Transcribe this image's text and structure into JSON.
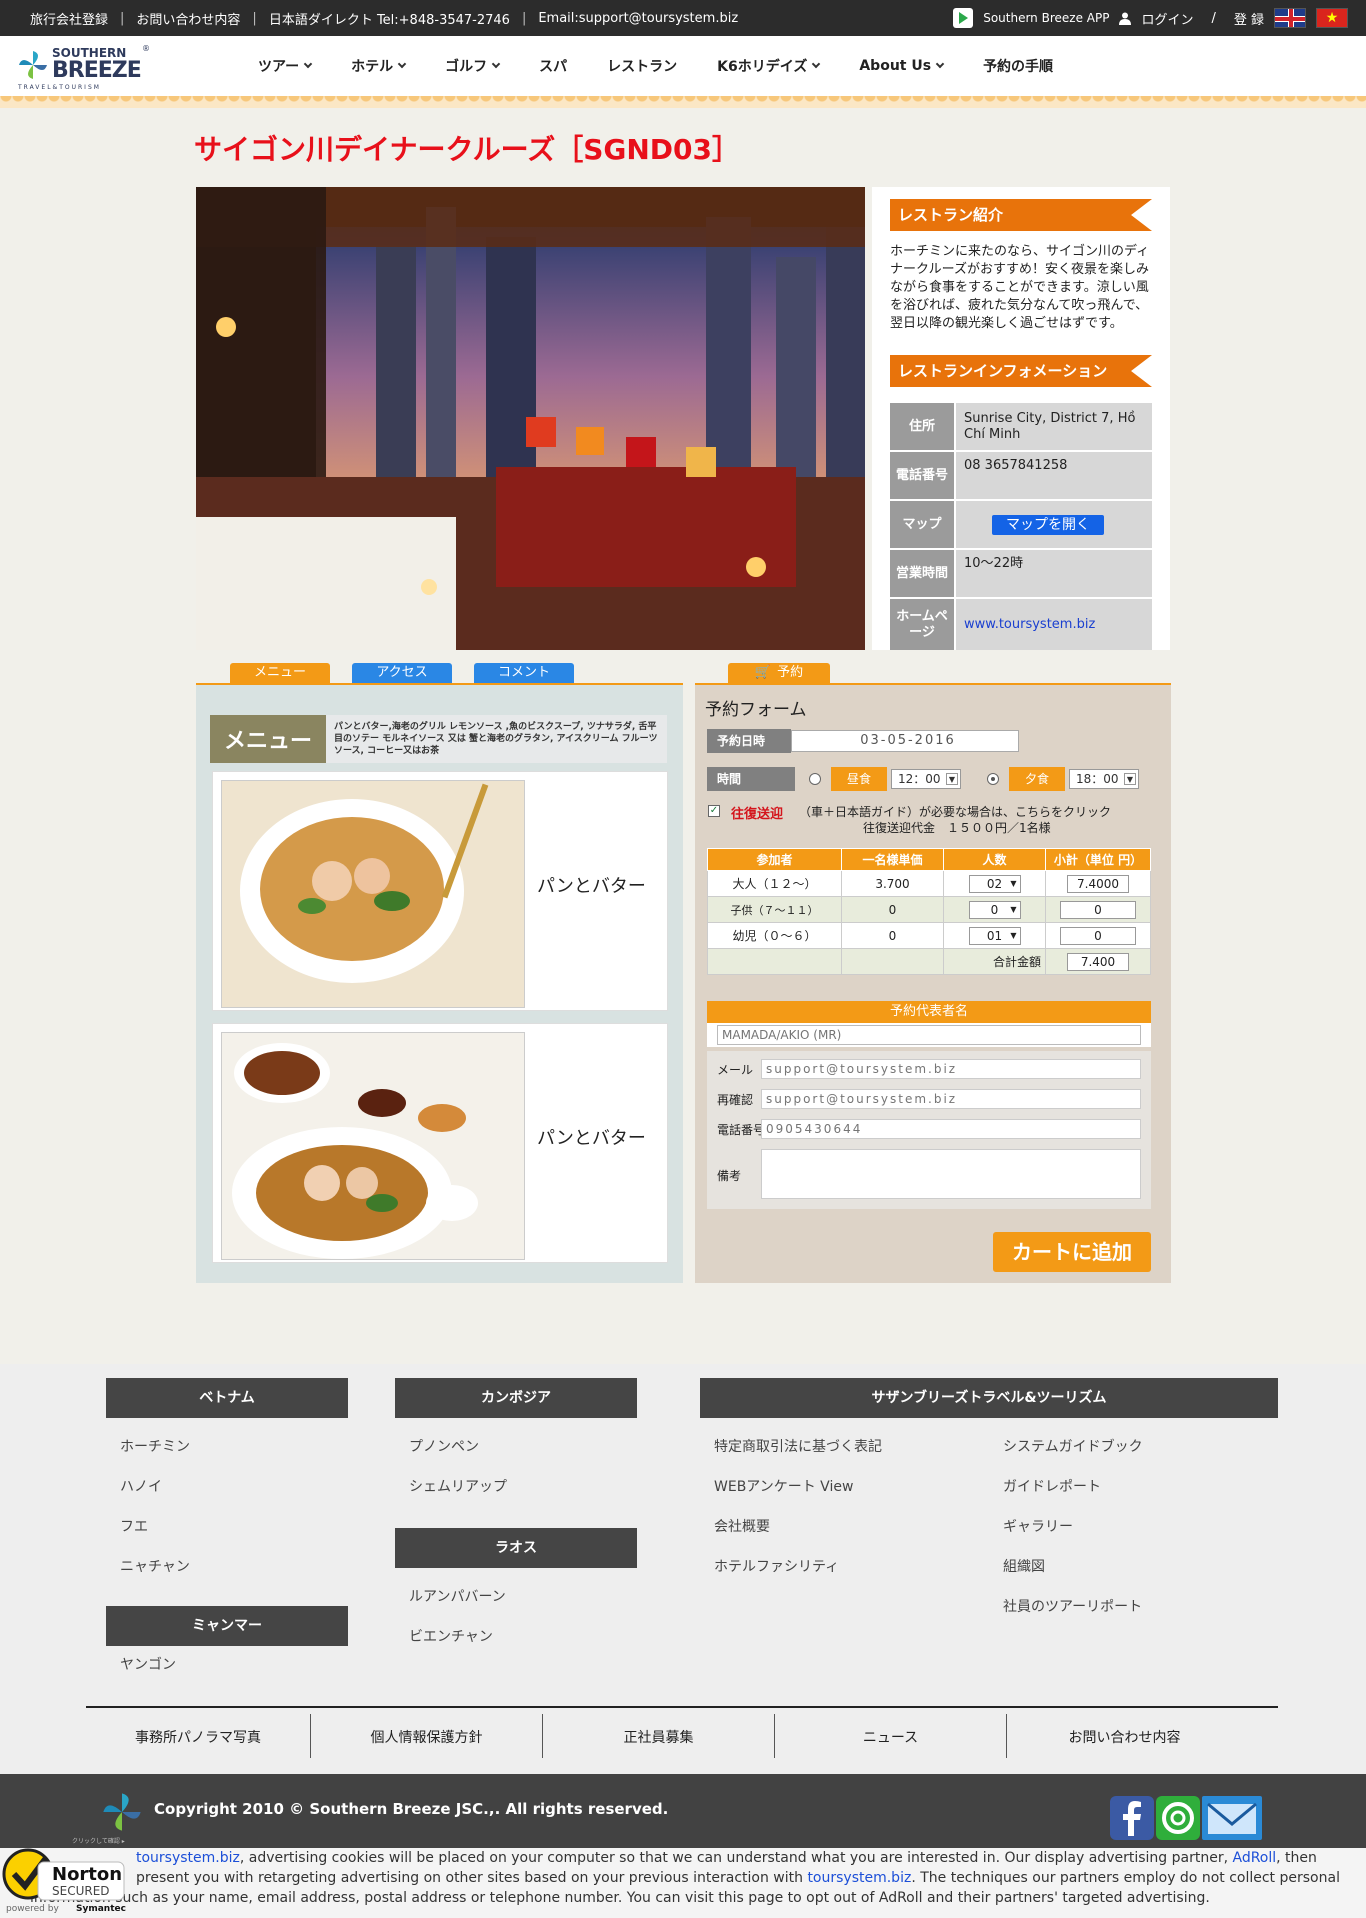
{
  "topbar": {
    "links": [
      "旅行会社登録",
      "お問い合わせ内容",
      "日本語ダイレクト Tel:+848-3547-2746",
      "Email:support@toursystem.biz"
    ],
    "app_label": "Southern Breeze APP",
    "login": "ログイン",
    "slash": "/",
    "register": "登 録"
  },
  "logo": {
    "line1": "SOUTHERN",
    "line2": "BREEZE",
    "line3": "TRAVEL&TOURISM",
    "reg": "®"
  },
  "nav": {
    "items": [
      "ツアー",
      "ホテル",
      "ゴルフ",
      "スパ",
      "レストラン",
      "K6ホリデイズ",
      "About Us",
      "予約の手順"
    ]
  },
  "page": {
    "title": "サイゴン川デイナークルーズ［SGND03］"
  },
  "info": {
    "intro_heading": "レストラン紹介",
    "intro_text": "ホーチミンに来たのなら、サイゴン川のディナークルーズがおすすめ！安く夜景を楽しみながら食事をすることができます。涼しい風を浴びれば、疲れた気分なんて吹っ飛んで、翌日以降の観光楽しく過ごせはずです。",
    "info_heading": "レストランインフォメーション",
    "rows": [
      {
        "key": "住所",
        "value": "Sunrise City, District 7, Hồ Chí Minh"
      },
      {
        "key": "電話番号",
        "value": "08 3657841258"
      },
      {
        "key": "マップ",
        "value": "マップを開く"
      },
      {
        "key": "営業時間",
        "value": "10〜22時"
      },
      {
        "key": "ホームページ",
        "value": "www.toursystem.biz"
      }
    ]
  },
  "tabs": {
    "menu": "メニュー",
    "access": "アクセス",
    "comment": "コメント",
    "booking": "予約"
  },
  "menu": {
    "label": "メニュー",
    "description": "パンとバター,海老のグリル レモンソース ,魚のビスクスープ, ツナサラダ, 舌平目のソテー モルネイソース 又は 蟹と海老のグラタン, アイスクリーム フルーツソース, コーヒー又はお茶",
    "dishes": [
      {
        "name": "パンとバター"
      },
      {
        "name": "パンとバター"
      }
    ]
  },
  "form": {
    "title": "予約フォーム",
    "date_label": "予約日時",
    "date_value": "03-05-2016",
    "time_label": "時間",
    "lunch_label": "昼食",
    "lunch_time": "12：00",
    "dinner_label": "夕食",
    "dinner_time": "18：00",
    "transfer_label": "往復送迎",
    "transfer_text": "（車＋日本語ガイド）が必要な場合は、こちらをクリック",
    "transfer_price": "往復送迎代金　１５００円／1名様",
    "table": {
      "headers": [
        "参加者",
        "一名様単価",
        "人数",
        "小計（単位 円）"
      ],
      "rows": [
        {
          "who": "大人（１２〜）",
          "price": "3.700",
          "qty": "02",
          "subtotal": "7.4000"
        },
        {
          "who": "子供（７〜１１）",
          "price": "0",
          "qty": "0",
          "subtotal": "0"
        },
        {
          "who": "幼児（０〜６）",
          "price": "0",
          "qty": "01",
          "subtotal": "0"
        }
      ],
      "total_label": "合計金額",
      "total_value": "7.400"
    },
    "rep_label": "予約代表者名",
    "rep_placeholder": "MAMADA/AKIO (MR)",
    "mail_label": "メール",
    "mail_placeholder": "support@toursystem.biz",
    "confirm_label": "再確認",
    "confirm_placeholder": "support@toursystem.biz",
    "phone_label": "電話番号",
    "phone_placeholder": "0905430644",
    "notes_label": "備考",
    "cart_button": "カートに追加"
  },
  "footer": {
    "vietnam": {
      "heading": "ベトナム",
      "links": [
        "ホーチミン",
        "ハノイ",
        "フエ",
        "ニャチャン"
      ]
    },
    "myanmar": {
      "heading": "ミャンマー",
      "links": [
        "ヤンゴン"
      ]
    },
    "cambodia": {
      "heading": "カンボジア",
      "links": [
        "プノンペン",
        "シェムリアップ"
      ]
    },
    "laos": {
      "heading": "ラオス",
      "links": [
        "ルアンパバーン",
        "ビエンチャン"
      ]
    },
    "company": {
      "heading": "サザンブリーズトラベル&ツーリズム",
      "col1": [
        "特定商取引法に基づく表記",
        "WEBアンケート View",
        "会社概要",
        "ホテルファシリティ"
      ],
      "col2": [
        "システムガイドブック",
        "ガイドレポート",
        "ギャラリー",
        "組織図",
        "社員のツアーリポート"
      ]
    },
    "bottom_links": [
      "事務所パノラマ写真",
      "個人情報保護方針",
      "正社員募集",
      "ニュース",
      "お問い合わせ内容"
    ],
    "copyright": "Copyright 2010 © Southern Breeze JSC.,. All rights reserved.",
    "pin_caption": "クリックして確認 ▸"
  },
  "cookie": {
    "p1": "toursystem.biz",
    "p2": ", advertising cookies will be placed on your computer so that we can understand what you are interested in. Our display advertising partner, ",
    "p3": "AdRoll",
    "p4": ", then",
    "p5": "present you with retargeting advertising on other sites based on your previous interaction with ",
    "p6": "toursystem.biz",
    "p7": ". The techniques our partners employ do not collect personal",
    "p8": "information such as your name, email address, postal address or telephone number. You can visit this page to opt out of AdRoll and their partners' targeted advertising."
  },
  "norton": {
    "brand": "Norton",
    "secured": "SECURED",
    "powered": "powered by",
    "symantec": "Symantec"
  }
}
